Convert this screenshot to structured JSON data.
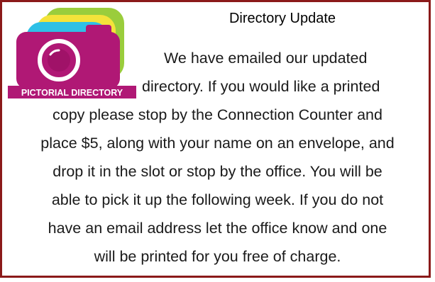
{
  "notice": {
    "logo_text": "PICTORIAL DIRECTORY",
    "heading": "Directory Update",
    "lines": [
      "We have emailed our updated",
      "directory. If you would like a printed",
      "copy please stop by the Connection Counter and",
      "place $5, along with your name on an envelope, and",
      "drop it in the slot or stop by the office. You will be",
      "able to pick it up the following week. If you do not",
      "have an email address let the office know and one",
      "will be printed for you free of charge."
    ]
  },
  "colors": {
    "border": "#8b1a1a",
    "logo_magenta": "#b01875",
    "logo_cyan": "#2ec0e6",
    "logo_green": "#9acd3c",
    "logo_yellow": "#f4e33a"
  }
}
